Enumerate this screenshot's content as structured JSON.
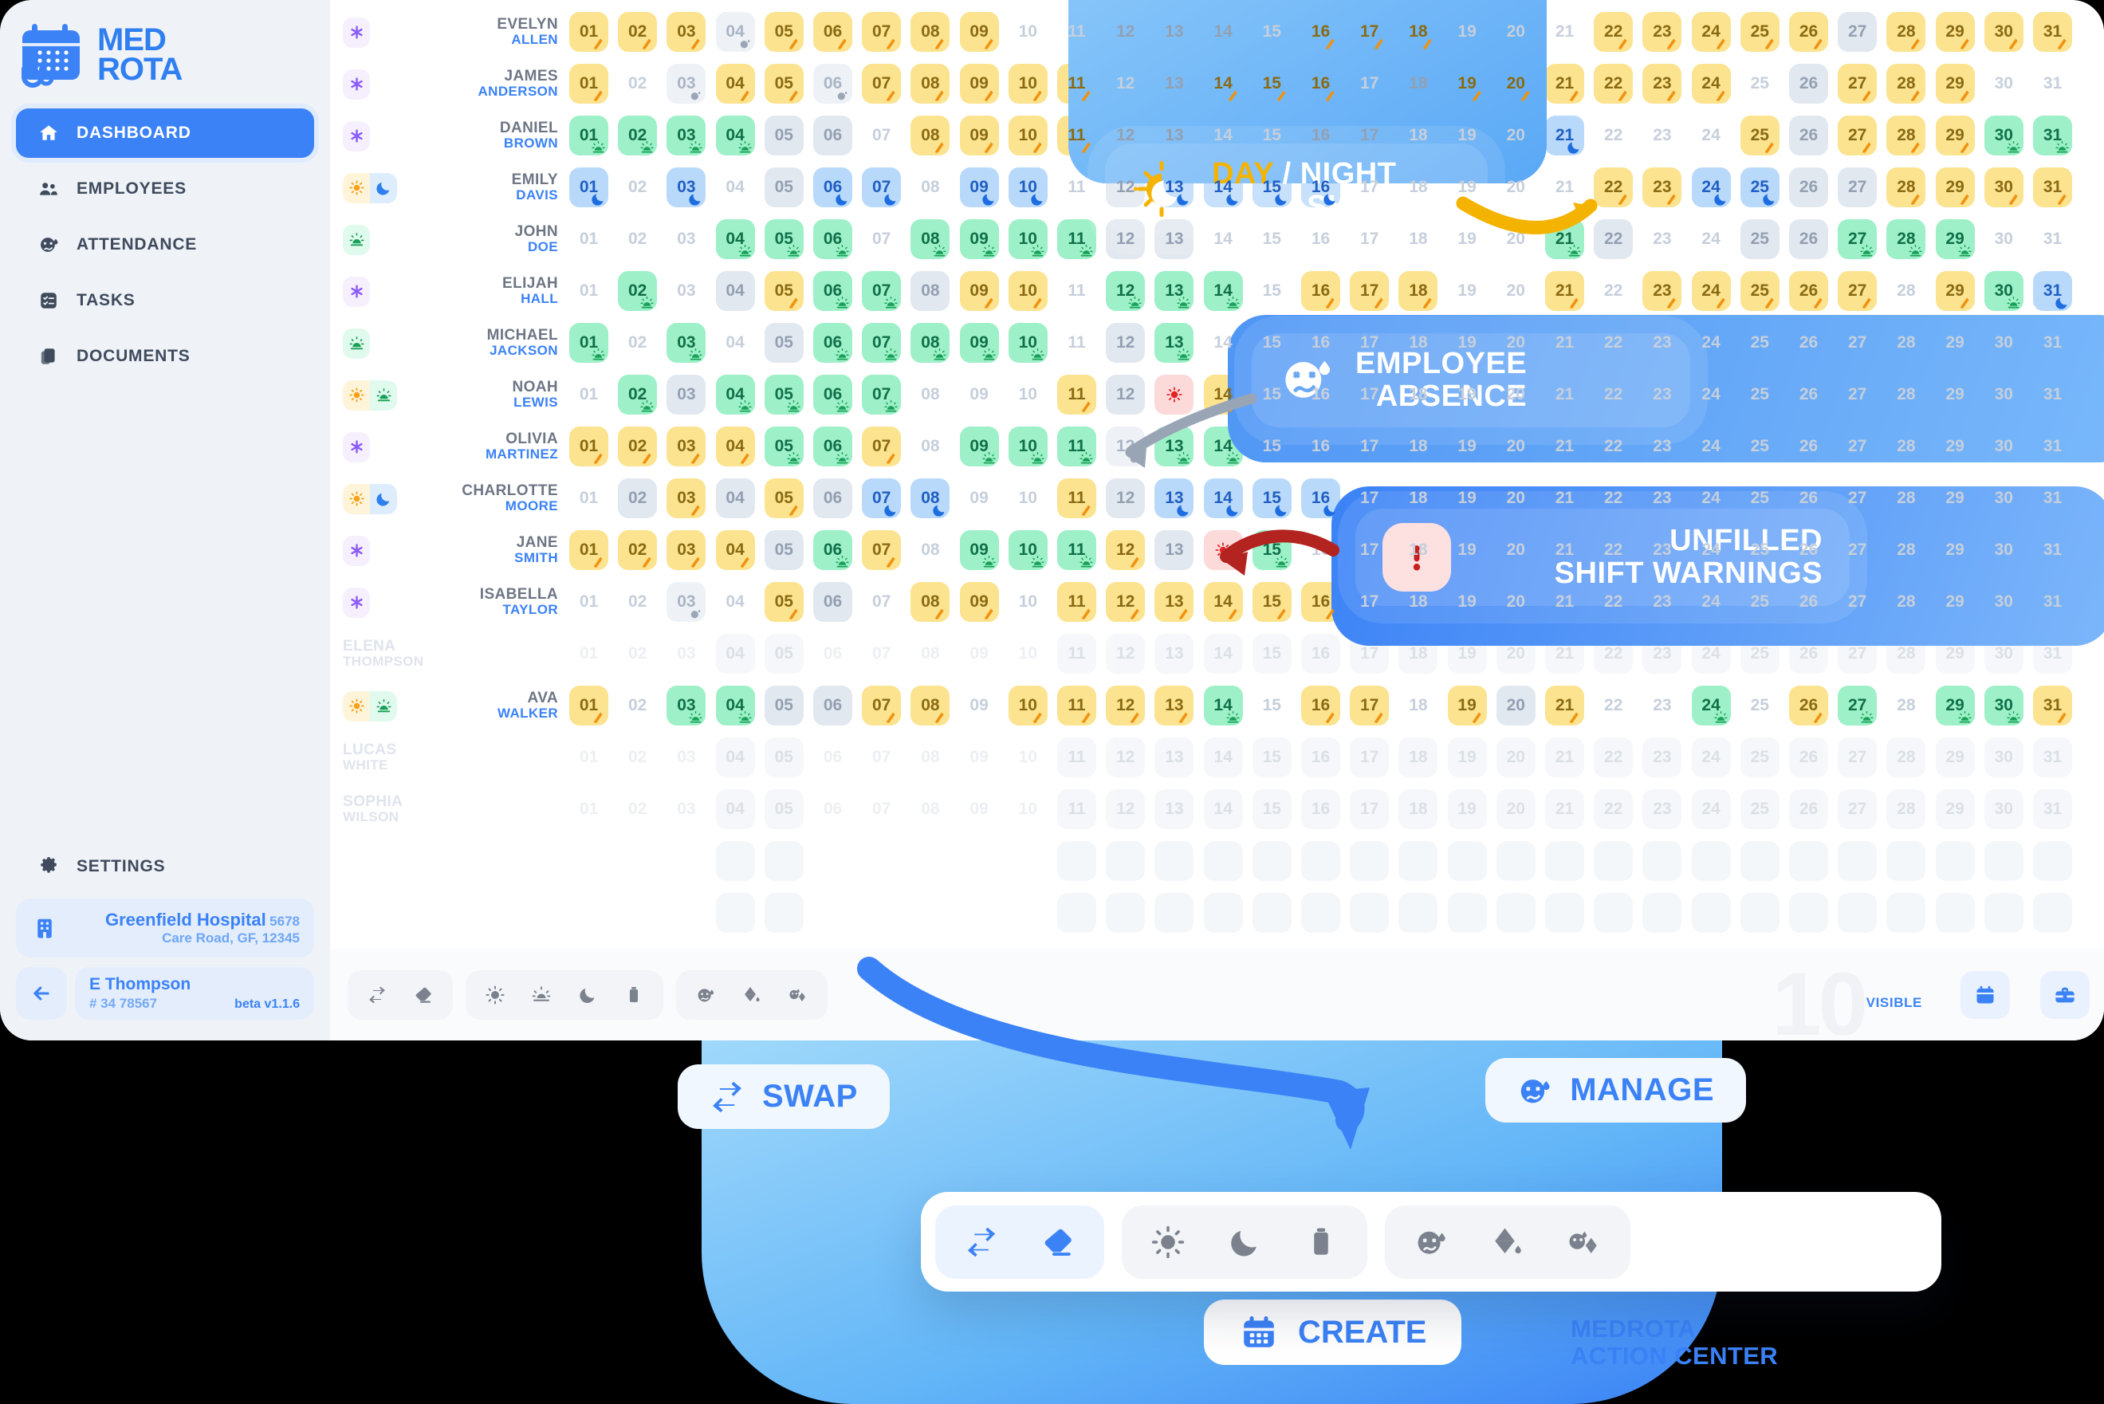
{
  "brand": {
    "line1": "MED",
    "line2": "ROTA",
    "logo_icon": "calendar-stethoscope-logo"
  },
  "sidebar": {
    "items": [
      {
        "label": "DASHBOARD",
        "icon": "home-icon",
        "active": true
      },
      {
        "label": "EMPLOYEES",
        "icon": "people-icon",
        "active": false
      },
      {
        "label": "ATTENDANCE",
        "icon": "sick-face-icon",
        "active": false
      },
      {
        "label": "TASKS",
        "icon": "task-list-icon",
        "active": false
      },
      {
        "label": "DOCUMENTS",
        "icon": "documents-icon",
        "active": false
      }
    ],
    "settings": {
      "label": "SETTINGS",
      "icon": "gear-icon"
    },
    "hospital": {
      "name": "Greenfield Hospital",
      "address": "5678 Care Road, GF, 12345",
      "icon": "hospital-icon"
    },
    "user": {
      "name": "E Thompson",
      "id": "# 34 78567",
      "version": "beta v1.1.6",
      "back_icon": "arrow-left-icon"
    }
  },
  "schedule": {
    "days": [
      "01",
      "02",
      "03",
      "04",
      "05",
      "06",
      "07",
      "08",
      "09",
      "10",
      "11",
      "12",
      "13",
      "14",
      "15",
      "16",
      "17",
      "18",
      "19",
      "20",
      "21",
      "22",
      "23",
      "24",
      "25",
      "26",
      "27",
      "28",
      "29",
      "30",
      "31"
    ],
    "legend": {
      "day": "day-shift",
      "eve": "evening-shift",
      "night": "night-shift",
      "off": "off-day",
      "absent": "employee-absence",
      "unfilled": "unfilled-shift-warning"
    },
    "rows": [
      {
        "first": "EVELYN",
        "last": "ALLEN",
        "badges": [
          "purple"
        ],
        "shifts": [
          "day",
          "day",
          "day",
          "absent",
          "day",
          "day",
          "day",
          "day",
          "day",
          "blank",
          "blank",
          "off",
          "off",
          "off",
          "blank",
          "day",
          "day",
          "day",
          "blank",
          "blank",
          "blank",
          "day",
          "day",
          "day",
          "day",
          "day",
          "off",
          "day",
          "day",
          "day",
          "day"
        ]
      },
      {
        "first": "JAMES",
        "last": "ANDERSON",
        "badges": [
          "purple"
        ],
        "shifts": [
          "day",
          "blank",
          "absent",
          "day",
          "day",
          "absent",
          "day",
          "day",
          "day",
          "day",
          "day",
          "blank",
          "off",
          "day",
          "day",
          "day",
          "blank",
          "off",
          "day",
          "day",
          "day",
          "day",
          "day",
          "day",
          "blank",
          "off",
          "day",
          "day",
          "day",
          "blank",
          "blank"
        ]
      },
      {
        "first": "DANIEL",
        "last": "BROWN",
        "badges": [
          "purple"
        ],
        "shifts": [
          "eve",
          "eve",
          "eve",
          "eve",
          "off",
          "off",
          "blank",
          "day",
          "day",
          "day",
          "day",
          "off",
          "off",
          "blank",
          "blank",
          "off",
          "off",
          "blank",
          "blank",
          "blank",
          "night",
          "blank",
          "blank",
          "blank",
          "day",
          "off",
          "day",
          "day",
          "day",
          "eve",
          "eve"
        ]
      },
      {
        "first": "EMILY",
        "last": "DAVIS",
        "badges": [
          "sun",
          "moon"
        ],
        "shifts": [
          "night",
          "blank",
          "night",
          "blank",
          "off",
          "night",
          "night",
          "blank",
          "night",
          "night",
          "blank",
          "off",
          "night",
          "night",
          "night",
          "night",
          "blank",
          "blank",
          "blank",
          "blank",
          "blank",
          "day",
          "day",
          "night",
          "night",
          "off",
          "off",
          "day",
          "day",
          "day",
          "day"
        ]
      },
      {
        "first": "JOHN",
        "last": "DOE",
        "badges": [
          "eve"
        ],
        "shifts": [
          "blank",
          "blank",
          "blank",
          "eve",
          "eve",
          "eve",
          "blank",
          "eve",
          "eve",
          "eve",
          "eve",
          "off",
          "off",
          "blank",
          "blank",
          "blank",
          "blank",
          "blank",
          "blank",
          "blank",
          "eve",
          "off",
          "blank",
          "blank",
          "off",
          "off",
          "eve",
          "eve",
          "eve",
          "blank",
          "blank"
        ]
      },
      {
        "first": "ELIJAH",
        "last": "HALL",
        "badges": [
          "purple"
        ],
        "shifts": [
          "blank",
          "eve",
          "blank",
          "off",
          "day",
          "eve",
          "eve",
          "off",
          "day",
          "day",
          "blank",
          "eve",
          "eve",
          "eve",
          "blank",
          "day",
          "day",
          "day",
          "blank",
          "blank",
          "day",
          "blank",
          "day",
          "day",
          "day",
          "day",
          "day",
          "blank",
          "day",
          "eve",
          "night"
        ]
      },
      {
        "first": "MICHAEL",
        "last": "JACKSON",
        "badges": [
          "eve"
        ],
        "shifts": [
          "eve",
          "blank",
          "eve",
          "blank",
          "off",
          "eve",
          "eve",
          "eve",
          "eve",
          "eve",
          "blank",
          "off",
          "eve",
          "blank",
          "blank",
          "blank",
          "blank",
          "blank",
          "blank",
          "blank",
          "blank",
          "blank",
          "blank",
          "blank",
          "blank",
          "blank",
          "blank",
          "blank",
          "blank",
          "blank",
          "blank"
        ]
      },
      {
        "first": "NOAH",
        "last": "LEWIS",
        "badges": [
          "sun",
          "eve"
        ],
        "shifts": [
          "blank",
          "eve",
          "off",
          "eve",
          "eve",
          "eve",
          "eve",
          "blank",
          "blank",
          "blank",
          "day",
          "off",
          "unfilled",
          "day",
          "blank",
          "blank",
          "blank",
          "blank",
          "blank",
          "blank",
          "blank",
          "blank",
          "blank",
          "blank",
          "blank",
          "blank",
          "blank",
          "blank",
          "blank",
          "blank",
          "blank"
        ]
      },
      {
        "first": "OLIVIA",
        "last": "MARTINEZ",
        "badges": [
          "purple"
        ],
        "shifts": [
          "day",
          "day",
          "day",
          "day",
          "eve",
          "eve",
          "day",
          "blank",
          "eve",
          "eve",
          "eve",
          "absent",
          "eve",
          "eve",
          "blank",
          "blank",
          "blank",
          "blank",
          "blank",
          "blank",
          "blank",
          "blank",
          "blank",
          "blank",
          "blank",
          "blank",
          "blank",
          "blank",
          "blank",
          "blank",
          "blank"
        ]
      },
      {
        "first": "CHARLOTTE",
        "last": "MOORE",
        "badges": [
          "sun",
          "moon"
        ],
        "shifts": [
          "blank",
          "off",
          "day",
          "off",
          "day",
          "off",
          "night",
          "night",
          "blank",
          "blank",
          "day",
          "off",
          "night",
          "night",
          "night",
          "night",
          "blank",
          "blank",
          "blank",
          "blank",
          "blank",
          "blank",
          "blank",
          "blank",
          "blank",
          "blank",
          "blank",
          "blank",
          "blank",
          "blank",
          "blank"
        ]
      },
      {
        "first": "JANE",
        "last": "SMITH",
        "badges": [
          "purple"
        ],
        "shifts": [
          "day",
          "day",
          "day",
          "day",
          "off",
          "eve",
          "day",
          "blank",
          "eve",
          "eve",
          "eve",
          "day",
          "off",
          "unfilled",
          "eve",
          "blank",
          "blank",
          "blank",
          "blank",
          "blank",
          "blank",
          "blank",
          "blank",
          "blank",
          "blank",
          "blank",
          "blank",
          "blank",
          "blank",
          "blank",
          "blank"
        ]
      },
      {
        "first": "ISABELLA",
        "last": "TAYLOR",
        "badges": [
          "purple"
        ],
        "shifts": [
          "blank",
          "blank",
          "absent",
          "blank",
          "day",
          "off",
          "blank",
          "day",
          "day",
          "blank",
          "day",
          "day",
          "day",
          "day",
          "day",
          "day",
          "blank",
          "blank",
          "blank",
          "blank",
          "blank",
          "blank",
          "blank",
          "blank",
          "blank",
          "blank",
          "blank",
          "blank",
          "blank",
          "blank",
          "blank"
        ]
      },
      {
        "first": "ELENA",
        "last": "THOMPSON",
        "badges": [],
        "ghost": true,
        "shifts": [
          "blank",
          "blank",
          "blank",
          "off",
          "off",
          "blank",
          "blank",
          "blank",
          "blank",
          "blank",
          "off",
          "off",
          "off",
          "off",
          "off",
          "off",
          "off",
          "off",
          "off",
          "off",
          "off",
          "off",
          "off",
          "off",
          "off",
          "off",
          "off",
          "off",
          "off",
          "off",
          "off"
        ]
      },
      {
        "first": "AVA",
        "last": "WALKER",
        "badges": [
          "sun",
          "eve"
        ],
        "shifts": [
          "day",
          "blank",
          "eve",
          "eve",
          "off",
          "off",
          "day",
          "day",
          "blank",
          "day",
          "day",
          "day",
          "day",
          "eve",
          "blank",
          "day",
          "day",
          "blank",
          "day",
          "off",
          "day",
          "blank",
          "blank",
          "eve",
          "blank",
          "day",
          "eve",
          "blank",
          "eve",
          "eve",
          "day"
        ]
      },
      {
        "first": "LUCAS",
        "last": "WHITE",
        "badges": [],
        "ghost": true,
        "shifts": [
          "blank",
          "blank",
          "blank",
          "off",
          "off",
          "blank",
          "blank",
          "blank",
          "blank",
          "blank",
          "off",
          "off",
          "off",
          "off",
          "off",
          "off",
          "off",
          "off",
          "off",
          "off",
          "off",
          "off",
          "off",
          "off",
          "off",
          "off",
          "off",
          "off",
          "off",
          "off",
          "off"
        ]
      },
      {
        "first": "SOPHIA",
        "last": "WILSON",
        "badges": [],
        "ghost": true,
        "shifts": [
          "blank",
          "blank",
          "blank",
          "off",
          "off",
          "blank",
          "blank",
          "blank",
          "blank",
          "blank",
          "off",
          "off",
          "off",
          "off",
          "off",
          "off",
          "off",
          "off",
          "off",
          "off",
          "off",
          "off",
          "off",
          "off",
          "off",
          "off",
          "off",
          "off",
          "off",
          "off",
          "off"
        ]
      }
    ],
    "placeholder_rows": 2
  },
  "toolbar": {
    "groups": [
      {
        "name": "edit",
        "buttons": [
          {
            "label": "Swap",
            "icon": "swap-arrows-icon"
          },
          {
            "label": "Erase",
            "icon": "eraser-icon"
          }
        ]
      },
      {
        "name": "shifts",
        "buttons": [
          {
            "label": "Day shift",
            "icon": "sun-icon"
          },
          {
            "label": "Evening shift",
            "icon": "sunset-icon"
          },
          {
            "label": "Night shift",
            "icon": "moon-icon"
          },
          {
            "label": "Delete",
            "icon": "trash-icon"
          }
        ]
      },
      {
        "name": "absence",
        "buttons": [
          {
            "label": "Sick",
            "icon": "sick-face-icon"
          },
          {
            "label": "Leave",
            "icon": "drop-fill-icon"
          },
          {
            "label": "Sick and leave",
            "icon": "sick-drop-icon"
          }
        ]
      }
    ],
    "visible_count": "10",
    "visible_label": "VISIBLE",
    "right_buttons": [
      {
        "label": "Calendar",
        "icon": "calendar-icon"
      },
      {
        "label": "Toolbox",
        "icon": "toolbox-icon"
      }
    ]
  },
  "callouts": [
    {
      "id": "day-night",
      "icon": "sun-moon-icon",
      "text_accent": "DAY",
      "text_rest": " / NIGHT",
      "line2": "SHIFT"
    },
    {
      "id": "absence",
      "icon": "sick-face-icon",
      "line1": "EMPLOYEE",
      "line2": "ABSENCE"
    },
    {
      "id": "unfilled",
      "icon": "exclamation-icon",
      "line1": "UNFILLED",
      "line2": "SHIFT WARNINGS"
    }
  ],
  "action_center": {
    "swap": {
      "label": "SWAP",
      "icon": "swap-arrows-icon"
    },
    "manage": {
      "label": "MANAGE",
      "icon": "sick-face-icon"
    },
    "create": {
      "label": "CREATE",
      "icon": "calendar-icon"
    },
    "brand_line1": "MEDROTA",
    "brand_line2": "ACTION CENTER",
    "toolbar_groups": [
      {
        "name": "edit",
        "accent": true,
        "buttons": [
          {
            "icon": "swap-arrows-icon"
          },
          {
            "icon": "eraser-icon"
          }
        ]
      },
      {
        "name": "shifts",
        "accent": false,
        "buttons": [
          {
            "icon": "sun-icon"
          },
          {
            "icon": "moon-icon"
          },
          {
            "icon": "trash-icon"
          }
        ]
      },
      {
        "name": "absence",
        "accent": false,
        "buttons": [
          {
            "icon": "sick-face-icon"
          },
          {
            "icon": "drop-fill-icon"
          },
          {
            "icon": "sick-drop-icon"
          }
        ]
      }
    ]
  },
  "colors": {
    "brand_blue": "#3b82f6",
    "day_shift": "#fbe38f",
    "evening_shift": "#9df0c7",
    "night_shift": "#b9d9fb",
    "off_day": "#e2e8f0",
    "unfilled": "#fcdada",
    "accent_yellow": "#f5b301"
  }
}
